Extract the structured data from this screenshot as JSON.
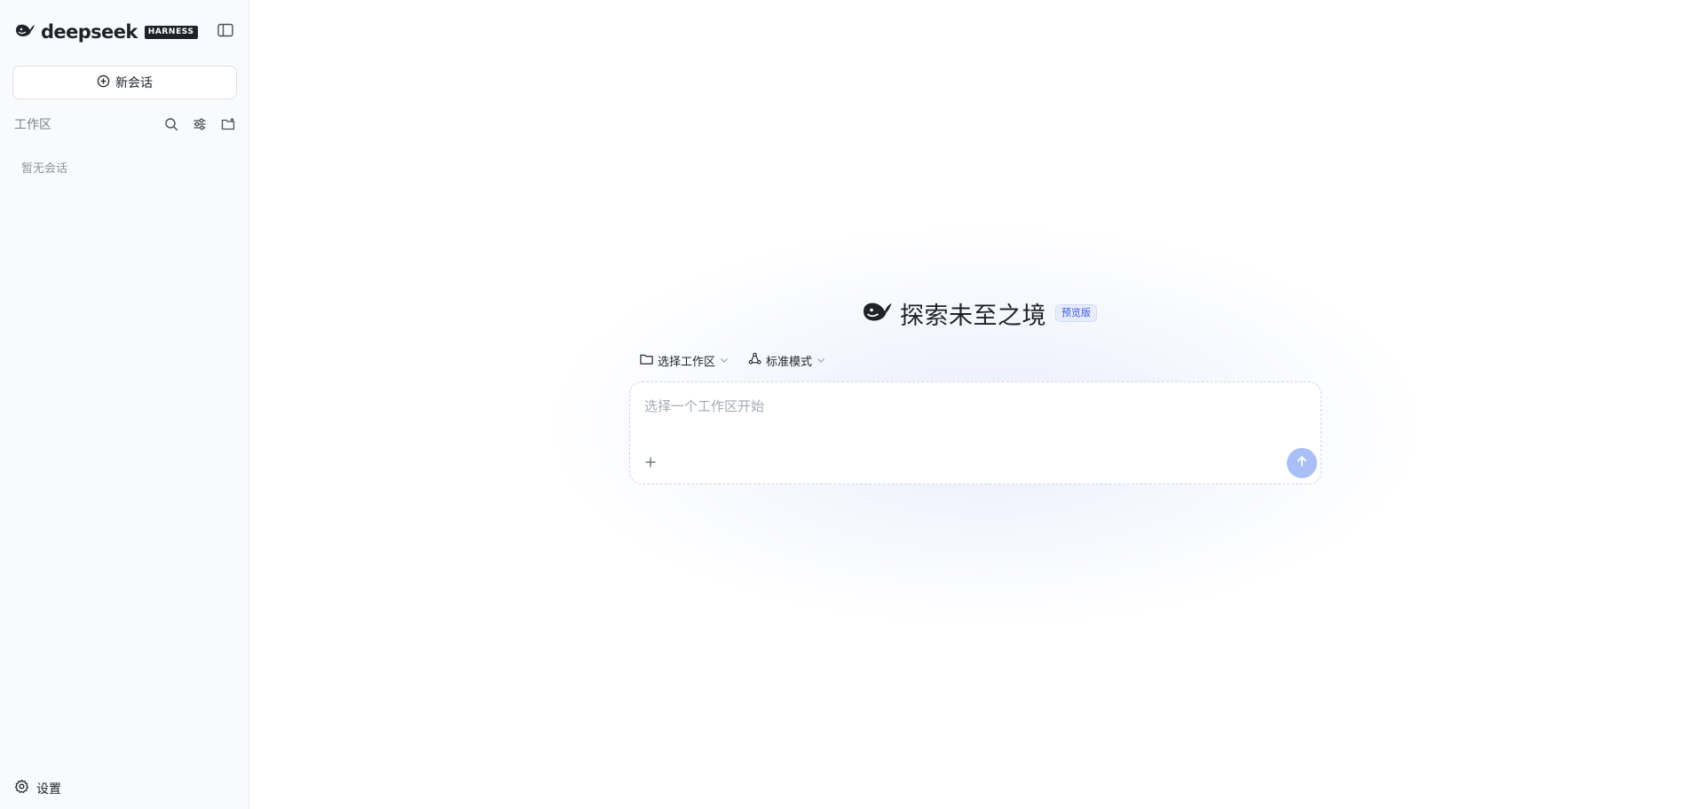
{
  "sidebar": {
    "brand": {
      "name": "deepseek",
      "badge": "HARNESS"
    },
    "new_chat_label": "新会话",
    "workspace_title": "工作区",
    "empty_label": "暂无会话",
    "settings_label": "设置"
  },
  "main": {
    "hero_title": "探索未至之境",
    "hero_badge": "预览版",
    "toolbar": {
      "workspace_select": "选择工作区",
      "mode_select": "标准模式"
    },
    "composer": {
      "placeholder": "选择一个工作区开始"
    }
  },
  "colors": {
    "accent": "#a9bff5",
    "badge_text": "#3b5bdb",
    "sidebar_bg": "#f9fafb"
  },
  "icons": [
    "whale-logo-icon",
    "sidebar-toggle-icon",
    "plus-circle-icon",
    "search-icon",
    "sliders-icon",
    "folder-plus-icon",
    "gear-icon",
    "folder-icon",
    "chevron-down-icon",
    "agent-loop-icon",
    "plus-icon",
    "arrow-up-icon"
  ]
}
